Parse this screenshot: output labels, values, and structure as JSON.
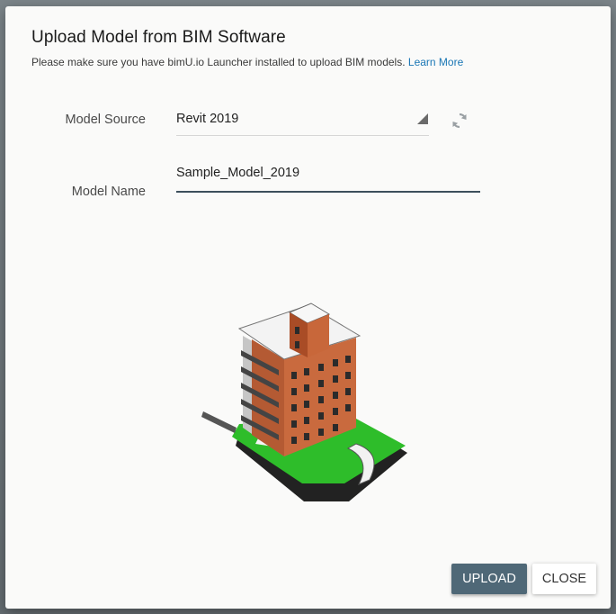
{
  "dialog": {
    "title": "Upload Model from BIM Software",
    "subtitle": "Please make sure you have bimU.io Launcher installed to upload BIM models.",
    "learn_more": "Learn More"
  },
  "form": {
    "model_source_label": "Model Source",
    "model_source_value": "Revit 2019",
    "model_name_label": "Model Name",
    "model_name_value": "Sample_Model_2019"
  },
  "icons": {
    "dropdown": "triangle-down-icon",
    "refresh": "refresh-icon"
  },
  "preview": {
    "image": "building-model-preview"
  },
  "buttons": {
    "upload": "UPLOAD",
    "close": "CLOSE"
  },
  "colors": {
    "accent": "#4f6877",
    "link": "#1976b5",
    "input_underline": "#3d4f5c"
  }
}
